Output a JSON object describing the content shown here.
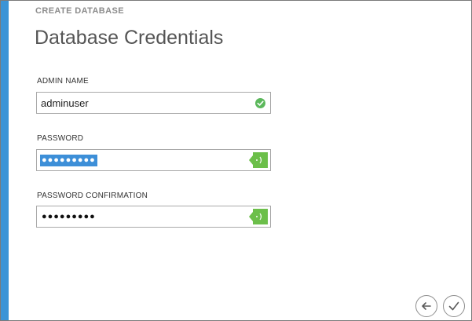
{
  "dialog": {
    "eyebrow": "CREATE DATABASE",
    "title": "Database Credentials"
  },
  "form": {
    "admin_name": {
      "label": "ADMIN NAME",
      "value": "adminuser",
      "status_icon": "check-circle-icon",
      "status_color": "#5cb85c"
    },
    "password": {
      "label": "PASSWORD",
      "masked_value": "●●●●●●●●●",
      "selected": true,
      "hint_icon": "password-hint-icon"
    },
    "password_confirmation": {
      "label": "PASSWORD CONFIRMATION",
      "masked_value": "●●●●●●●●●",
      "hint_icon": "password-hint-icon"
    }
  },
  "footer": {
    "back_icon": "back-arrow-icon",
    "complete_icon": "checkmark-icon"
  },
  "colors": {
    "accent": "#3c94d6",
    "hint_green": "#6cbf4a",
    "valid_green": "#5cb85c",
    "selection_blue": "#3d8fd8"
  }
}
